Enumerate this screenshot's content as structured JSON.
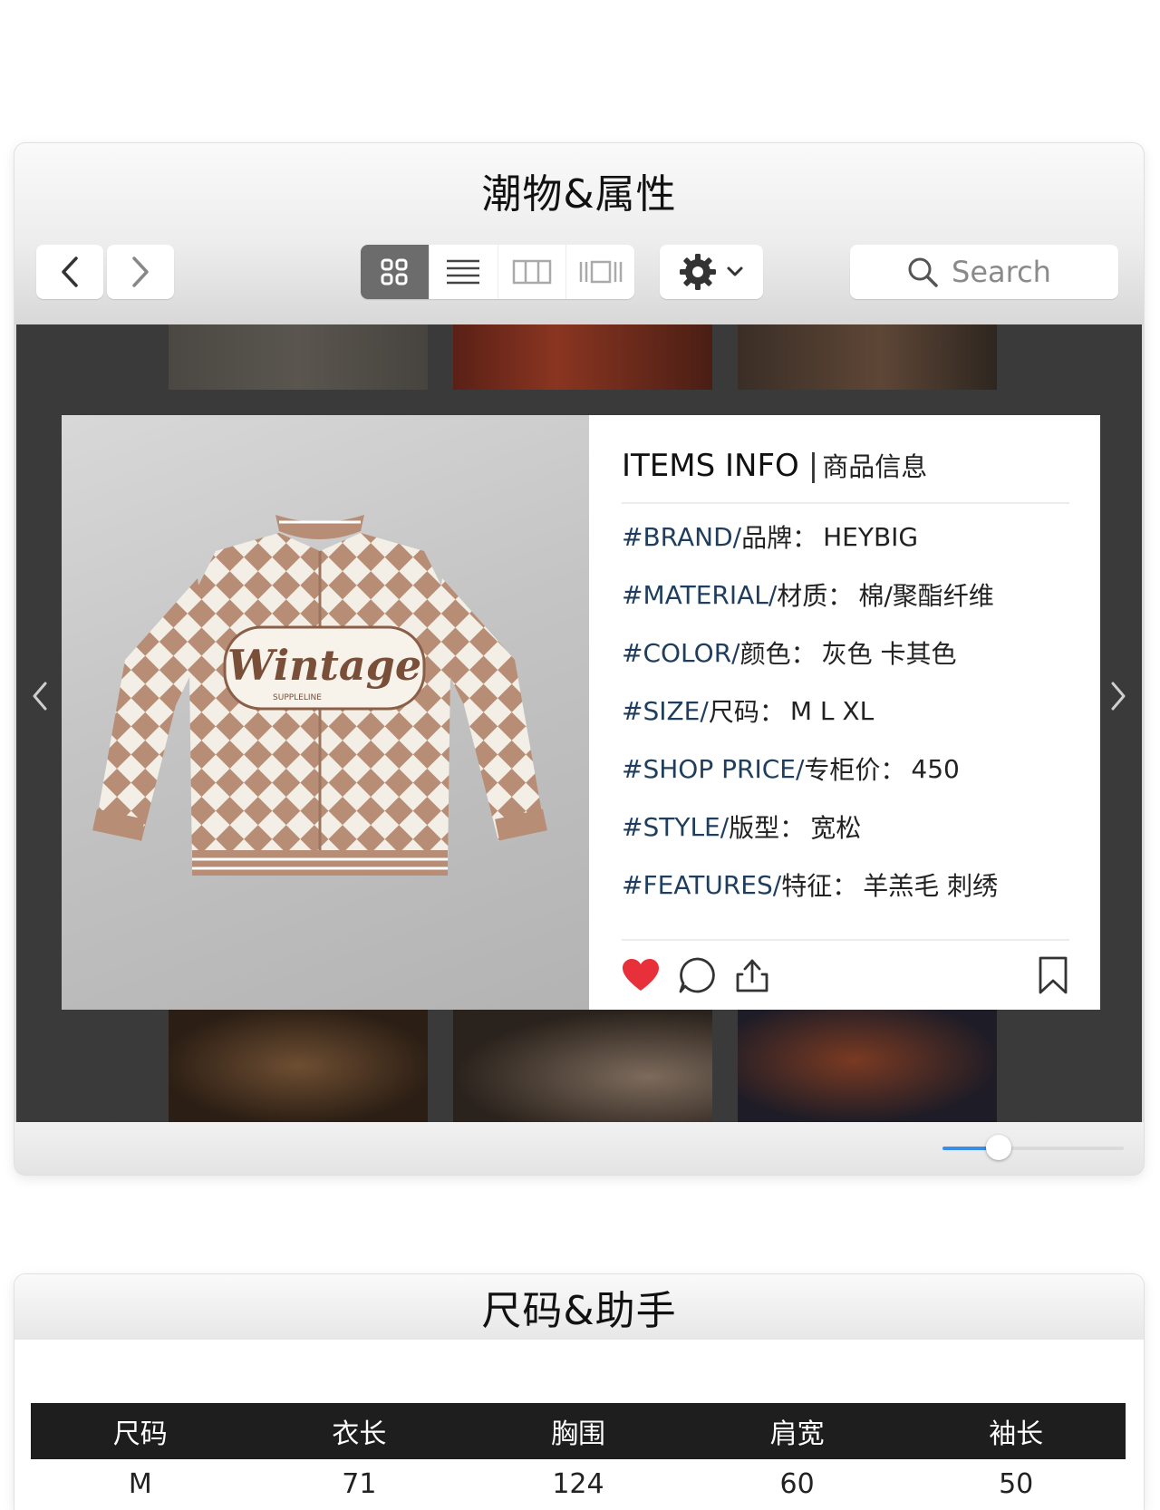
{
  "window": {
    "title": "潮物&属性",
    "toolbar": {
      "back_icon": "chevron-left-icon",
      "forward_icon": "chevron-right-icon",
      "view_modes": [
        "icon-view",
        "list-view",
        "column-view",
        "gallery-view"
      ],
      "active_view": "icon-view",
      "action_icon": "gear-icon",
      "search_placeholder": "Search"
    },
    "slider": {
      "value": 0.31,
      "accent": "#3b8ee8"
    }
  },
  "card": {
    "heading": "ITEMS INFO",
    "heading_sep": "|",
    "heading_cn": "商品信息",
    "image": {
      "logo_text": "Wintage",
      "logo_sub": "SUPPLELINE"
    },
    "rows": [
      {
        "tag": "#BRAND/",
        "label": "品牌：",
        "value": "HEYBIG"
      },
      {
        "tag": "#MATERIAL/",
        "label": "材质：",
        "value": "棉/聚酯纤维"
      },
      {
        "tag": "#COLOR/",
        "label": "颜色：",
        "value": "灰色 卡其色"
      },
      {
        "tag": "#SIZE/",
        "label": "尺码：",
        "value": " M L XL"
      },
      {
        "tag": "#SHOP PRICE/",
        "label": "专柜价：",
        "value": "450"
      },
      {
        "tag": "#STYLE/",
        "label": "版型：",
        "value": "宽松"
      },
      {
        "tag": "#FEATURES/",
        "label": "特征：",
        "value": "羊羔毛 刺绣"
      }
    ],
    "actions": {
      "like_color": "#e8303a",
      "icons": [
        "heart-icon",
        "comment-icon",
        "share-icon",
        "bookmark-icon"
      ]
    }
  },
  "size_panel": {
    "title": "尺码&助手",
    "columns": [
      "尺码",
      "衣长",
      "胸围",
      "肩宽",
      "袖长"
    ],
    "first_row": [
      "M",
      "71",
      "124",
      "60",
      "50"
    ]
  },
  "colors": {
    "tag_text": "#1f3d5c",
    "content_bg": "#3a3a3a",
    "table_header": "#1e1e1e"
  }
}
